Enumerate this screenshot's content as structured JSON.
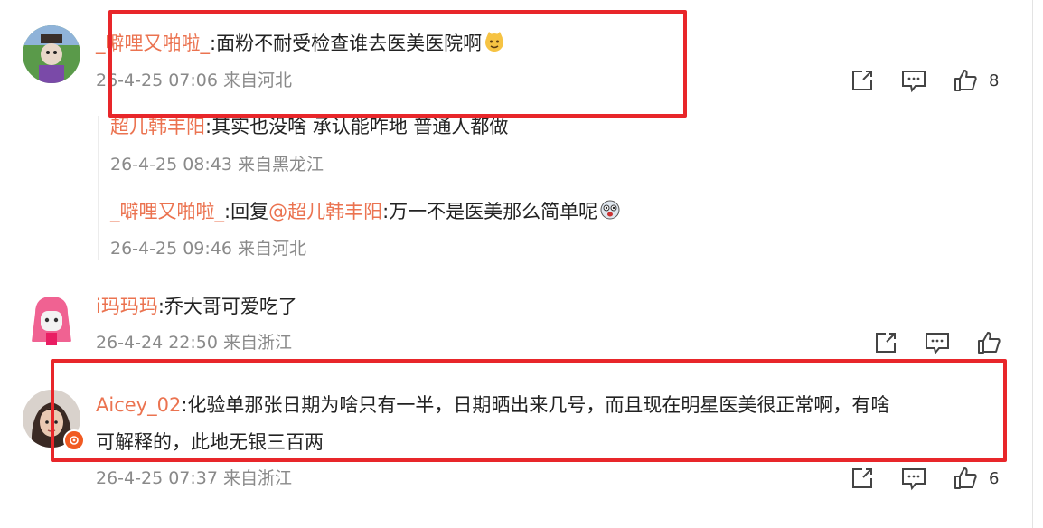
{
  "comments": [
    {
      "user": "_噼哩又啪啦_",
      "text": "面粉不耐受检查谁去医美医院啊",
      "time": "26-4-25 07:06 来自河北",
      "likes": "8",
      "replies": [
        {
          "user": "超儿韩丰阳",
          "text": "其实也没啥 承认能咋地 普通人都做",
          "time": "26-4-25 08:43 来自黑龙江"
        },
        {
          "user": "_噼哩又啪啦_",
          "reply_label": "回复",
          "mention": "@超儿韩丰阳",
          "text": "万一不是医美那么简单呢",
          "time": "26-4-25 09:46 来自河北"
        }
      ]
    },
    {
      "user": "i玛玛玛",
      "text": "乔大哥可爱吃了",
      "time": "26-4-24 22:50 来自浙江",
      "likes": ""
    },
    {
      "user": "Aicey_02",
      "text_line1": "化验单那张日期为啥只有一半，日期晒出来几号，而且现在明星医美很正常啊，有啥",
      "text_line2": "可解释的，此地无银三百两",
      "time": "26-4-25 07:37 来自浙江",
      "likes": "6"
    }
  ],
  "colon": ":",
  "icons": {
    "share": "share-icon",
    "comment": "comment-icon",
    "like": "thumbs-up-icon"
  },
  "colors": {
    "username": "#eb7350",
    "highlight_box": "#e8262a",
    "meta": "#8a8a8a"
  }
}
